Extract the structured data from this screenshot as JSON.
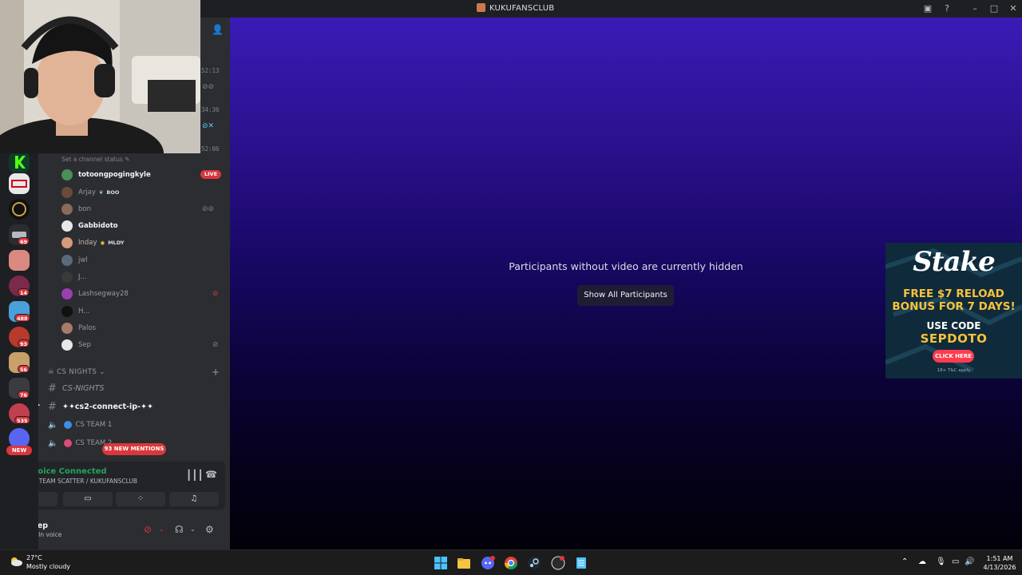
{
  "window": {
    "title": "KUKUFANSCLUB",
    "controls": [
      "minimize",
      "maximize",
      "close"
    ]
  },
  "server_rail": {
    "badges": [
      "69",
      "14",
      "488",
      "93",
      "56",
      "76",
      "535"
    ],
    "new_label": "NEW"
  },
  "sidebar": {
    "timestamps": [
      "52:13",
      "34:36",
      "52:06"
    ],
    "channel_status_placeholder": "Set a channel status",
    "voice_users": [
      {
        "name": "totoongpogingkyle",
        "live": "LIVE"
      },
      {
        "name": "Arjay",
        "tag": "BOO"
      },
      {
        "name": "bon"
      },
      {
        "name": "Gabbidoto"
      },
      {
        "name": "Inday",
        "tag": "MLDY"
      },
      {
        "name": "jwl"
      },
      {
        "name": "J..."
      },
      {
        "name": "Lashsegway28"
      },
      {
        "name": "H..."
      },
      {
        "name": "Palos"
      },
      {
        "name": "Sep"
      }
    ],
    "category": "CS NIGHTS",
    "channels": [
      {
        "label": "CS-NIGHTS"
      },
      {
        "label": "✦✦cs2-connect-ip-✦✦"
      },
      {
        "label": "CS TEAM 1"
      },
      {
        "label": "CS TEAM 2"
      }
    ],
    "mentions_pill": "93 NEW MENTIONS"
  },
  "voice_panel": {
    "title": "Voice Connected",
    "subtitle": "TEAM SCATTER / KUKUFANSCLUB"
  },
  "user_panel": {
    "name": "Sep",
    "status": "In voice"
  },
  "stage": {
    "message": "Participants without video are currently hidden",
    "button": "Show All Participants"
  },
  "ad": {
    "brand": "Stake",
    "line1": "FREE $7 RELOAD",
    "line2": "BONUS FOR 7 DAYS!",
    "use_code": "USE CODE",
    "code": "SEPDOTO",
    "cta": "CLICK HERE",
    "footer": "18+ T&C apply"
  },
  "taskbar": {
    "temperature": "27°C",
    "condition": "Mostly cloudy",
    "time": "1:51 AM",
    "date": "4/13/2026"
  }
}
